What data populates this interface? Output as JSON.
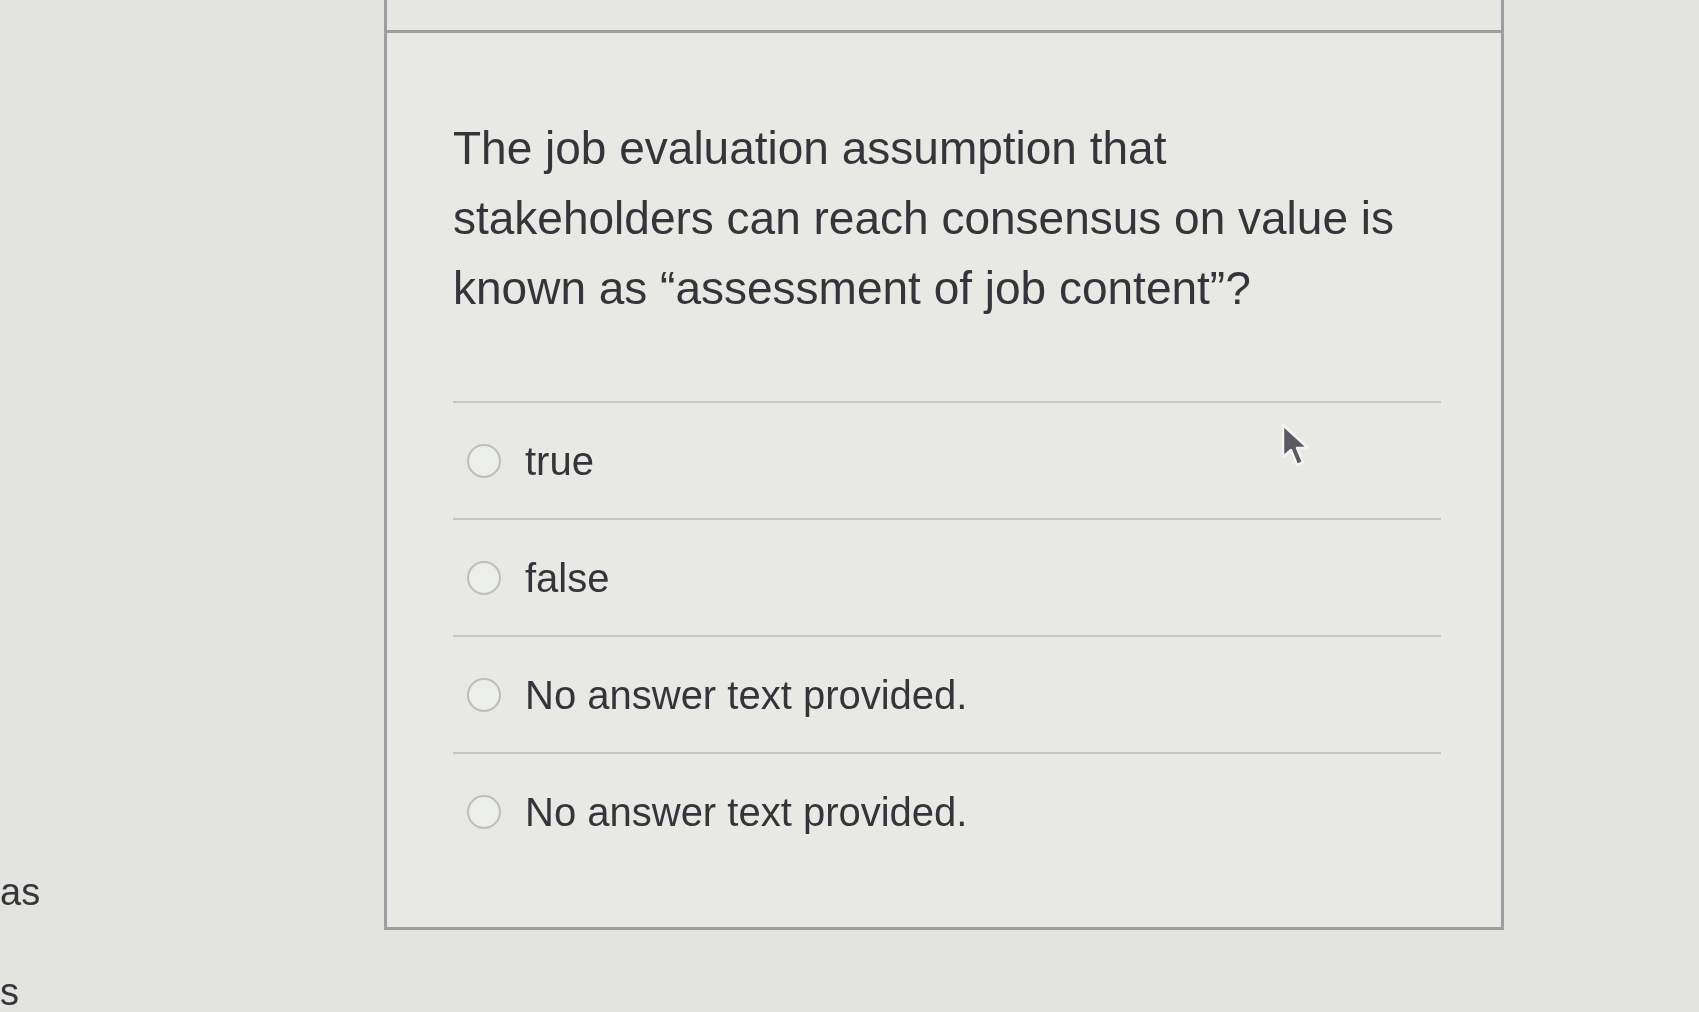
{
  "question": {
    "text": "The job evaluation assumption that stakeholders can reach consensus on value is known as “assessment of job content”?"
  },
  "options": [
    {
      "label": "true",
      "selected": false
    },
    {
      "label": "false",
      "selected": false
    },
    {
      "label": "No answer text provided.",
      "selected": false
    },
    {
      "label": "No answer text provided.",
      "selected": false
    }
  ],
  "side_text": [
    "as",
    "s"
  ]
}
